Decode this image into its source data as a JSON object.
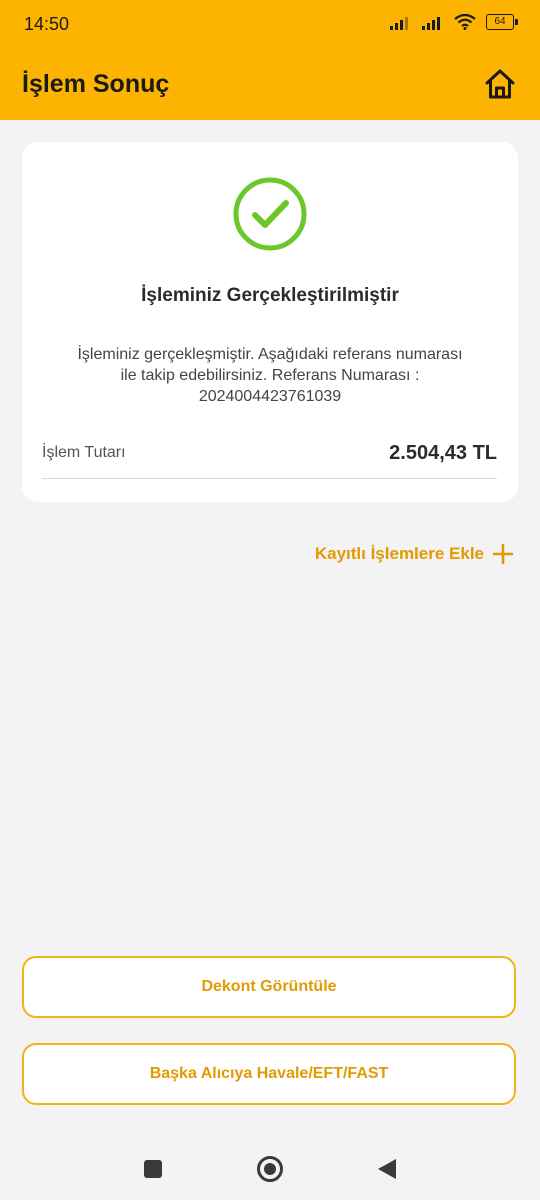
{
  "status_bar": {
    "time": "14:50",
    "battery": "64"
  },
  "header": {
    "title": "İşlem Sonuç",
    "home_icon": "home-icon"
  },
  "result_card": {
    "icon": "check-circle-icon",
    "success_color": "#6cc72a",
    "title": "İşleminiz Gerçekleştirilmiştir",
    "description": "İşleminiz gerçekleşmiştir. Aşağıdaki referans numarası ile takip edebilirsiniz. Referans Numarası : 2024004423761039",
    "amount_label": "İşlem Tutarı",
    "amount_value": "2.504,43 TL"
  },
  "save_link": {
    "label": "Kayıtlı İşlemlere Ekle",
    "icon": "plus-icon"
  },
  "actions": {
    "dekont_label": "Dekont Görüntüle",
    "havale_label": "Başka Alıcıya Havale/EFT/FAST"
  },
  "colors": {
    "brand": "#fcb400",
    "accent_text": "#e39a00",
    "background": "#f3f3f3"
  }
}
